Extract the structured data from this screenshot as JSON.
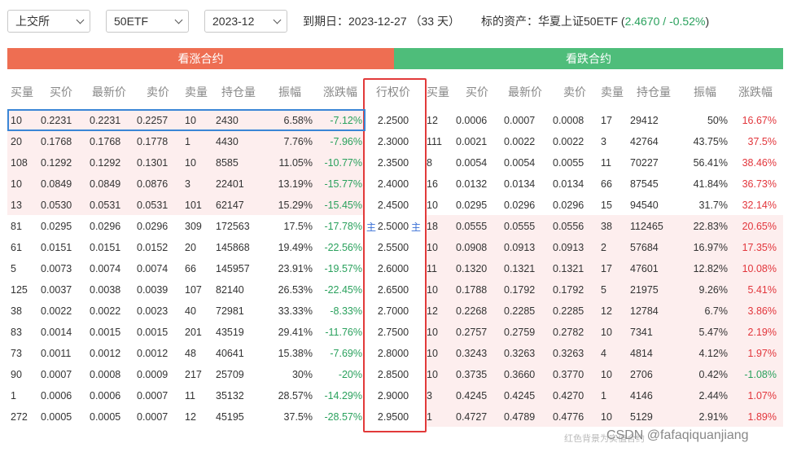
{
  "toolbar": {
    "exchange": "上交所",
    "underlying": "50ETF",
    "month": "2023-12",
    "expiry_label": "到期日：2023-12-27 （33 天）",
    "asset_label": "标的资产：华夏上证50ETF (",
    "asset_price": "2.4670 / -0.52%",
    "asset_close": ")"
  },
  "bands": {
    "call": "看涨合约",
    "put": "看跌合约"
  },
  "headers": {
    "call": [
      "买量",
      "买价",
      "最新价",
      "卖价",
      "卖量",
      "持仓量",
      "振幅",
      "涨跌幅"
    ],
    "strike": "行权价",
    "put": [
      "买量",
      "买价",
      "最新价",
      "卖价",
      "卖量",
      "持仓量",
      "振幅",
      "涨跌幅"
    ]
  },
  "calls": [
    [
      "10",
      "0.2231",
      "0.2231",
      "0.2257",
      "10",
      "2430",
      "6.58%",
      "-7.12%"
    ],
    [
      "20",
      "0.1768",
      "0.1768",
      "0.1778",
      "1",
      "4430",
      "7.76%",
      "-7.96%"
    ],
    [
      "108",
      "0.1292",
      "0.1292",
      "0.1301",
      "10",
      "8585",
      "11.05%",
      "-10.77%"
    ],
    [
      "10",
      "0.0849",
      "0.0849",
      "0.0876",
      "3",
      "22401",
      "13.19%",
      "-15.77%"
    ],
    [
      "13",
      "0.0530",
      "0.0531",
      "0.0531",
      "101",
      "62147",
      "15.29%",
      "-15.45%"
    ],
    [
      "81",
      "0.0295",
      "0.0296",
      "0.0296",
      "309",
      "172563",
      "17.5%",
      "-17.78%"
    ],
    [
      "61",
      "0.0151",
      "0.0151",
      "0.0152",
      "20",
      "145868",
      "19.49%",
      "-22.56%"
    ],
    [
      "5",
      "0.0073",
      "0.0074",
      "0.0074",
      "66",
      "145957",
      "23.91%",
      "-19.57%"
    ],
    [
      "125",
      "0.0037",
      "0.0038",
      "0.0039",
      "107",
      "82140",
      "26.53%",
      "-22.45%"
    ],
    [
      "38",
      "0.0022",
      "0.0022",
      "0.0023",
      "40",
      "72981",
      "33.33%",
      "-8.33%"
    ],
    [
      "83",
      "0.0014",
      "0.0015",
      "0.0015",
      "201",
      "43519",
      "29.41%",
      "-11.76%"
    ],
    [
      "73",
      "0.0011",
      "0.0012",
      "0.0012",
      "48",
      "40641",
      "15.38%",
      "-7.69%"
    ],
    [
      "90",
      "0.0007",
      "0.0008",
      "0.0009",
      "217",
      "25709",
      "30%",
      "-20%"
    ],
    [
      "1",
      "0.0006",
      "0.0006",
      "0.0007",
      "11",
      "35132",
      "28.57%",
      "-14.29%"
    ],
    [
      "272",
      "0.0005",
      "0.0005",
      "0.0007",
      "12",
      "45195",
      "37.5%",
      "-28.57%"
    ]
  ],
  "strikes": [
    "2.2500",
    "2.3000",
    "2.3500",
    "2.4000",
    "2.4500",
    "2.5000",
    "2.5500",
    "2.6000",
    "2.6500",
    "2.7000",
    "2.7500",
    "2.8000",
    "2.8500",
    "2.9000",
    "2.9500"
  ],
  "puts": [
    [
      "12",
      "0.0006",
      "0.0007",
      "0.0008",
      "17",
      "29412",
      "50%",
      "16.67%"
    ],
    [
      "111",
      "0.0021",
      "0.0022",
      "0.0022",
      "3",
      "42764",
      "43.75%",
      "37.5%"
    ],
    [
      "8",
      "0.0054",
      "0.0054",
      "0.0055",
      "11",
      "70227",
      "56.41%",
      "38.46%"
    ],
    [
      "16",
      "0.0132",
      "0.0134",
      "0.0134",
      "66",
      "87545",
      "41.84%",
      "36.73%"
    ],
    [
      "10",
      "0.0295",
      "0.0296",
      "0.0296",
      "15",
      "94540",
      "31.7%",
      "32.14%"
    ],
    [
      "18",
      "0.0555",
      "0.0555",
      "0.0556",
      "38",
      "112465",
      "22.83%",
      "20.65%"
    ],
    [
      "10",
      "0.0908",
      "0.0913",
      "0.0913",
      "2",
      "57684",
      "16.97%",
      "17.35%"
    ],
    [
      "11",
      "0.1320",
      "0.1321",
      "0.1321",
      "17",
      "47601",
      "12.82%",
      "10.08%"
    ],
    [
      "10",
      "0.1788",
      "0.1792",
      "0.1792",
      "5",
      "21975",
      "9.26%",
      "5.41%"
    ],
    [
      "12",
      "0.2268",
      "0.2285",
      "0.2285",
      "12",
      "12784",
      "6.7%",
      "3.86%"
    ],
    [
      "10",
      "0.2757",
      "0.2759",
      "0.2782",
      "10",
      "7341",
      "5.47%",
      "2.19%"
    ],
    [
      "10",
      "0.3243",
      "0.3263",
      "0.3263",
      "4",
      "4814",
      "4.12%",
      "1.97%"
    ],
    [
      "10",
      "0.3735",
      "0.3660",
      "0.3770",
      "10",
      "2706",
      "0.42%",
      "-1.08%"
    ],
    [
      "3",
      "0.4245",
      "0.4245",
      "0.4270",
      "1",
      "4146",
      "2.44%",
      "1.07%"
    ],
    [
      "1",
      "0.4727",
      "0.4789",
      "0.4776",
      "10",
      "5129",
      "2.91%",
      "1.89%"
    ]
  ],
  "lock_glyph": "主",
  "watermark": {
    "small": "红色背景为实值合约",
    "main": "CSDN @fafaqiquanjiang"
  },
  "colors": {
    "up": "#e2363c",
    "down": "#2aa15d",
    "call_band": "#ee6e52",
    "put_band": "#4ebd7a",
    "itm_bg": "#fdeeee"
  }
}
